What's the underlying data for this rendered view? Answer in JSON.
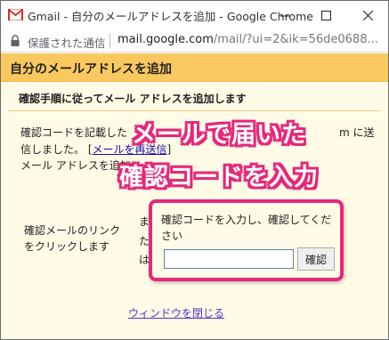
{
  "window": {
    "title": "Gmail - 自分のメールアドレスを追加 - Google Chrome",
    "minimize_glyph": "—",
    "maximize_glyph": "☐",
    "close_glyph": "✕"
  },
  "addressbar": {
    "secure_label": "保護された通信",
    "url_host": "mail.google.com",
    "url_path": "/mail/?ui=2&ik=56de0688..."
  },
  "page": {
    "header_title": "自分のメールアドレスを追加",
    "instruction": "確認手順に従ってメール アドレスを追加します",
    "para_line1": "確認コードを記載した",
    "para_line1_end": "m に送",
    "para_line2_prefix": "信しました。 [",
    "resend_link": "メールを再送信",
    "para_line2_suffix": "]",
    "para_line3": "メール アドレスを追加",
    "left_label_line1": "確認メールのリンク",
    "left_label_line2": "をクリックします",
    "frag1": "ま",
    "frag2": "た",
    "frag3": "は",
    "verify_prompt": "確認コードを入力し、確認してください",
    "code_input_value": "",
    "verify_button": "確認",
    "close_window_link": "ウィンドウを閉じる"
  },
  "overlay": {
    "line1": "メールで届いた",
    "line2": "確認コードを入力",
    "accent_color": "#e5287a"
  },
  "colors": {
    "header_band": "#f9c85f",
    "content_bg": "#fffbe6",
    "link": "#1a0dab"
  }
}
